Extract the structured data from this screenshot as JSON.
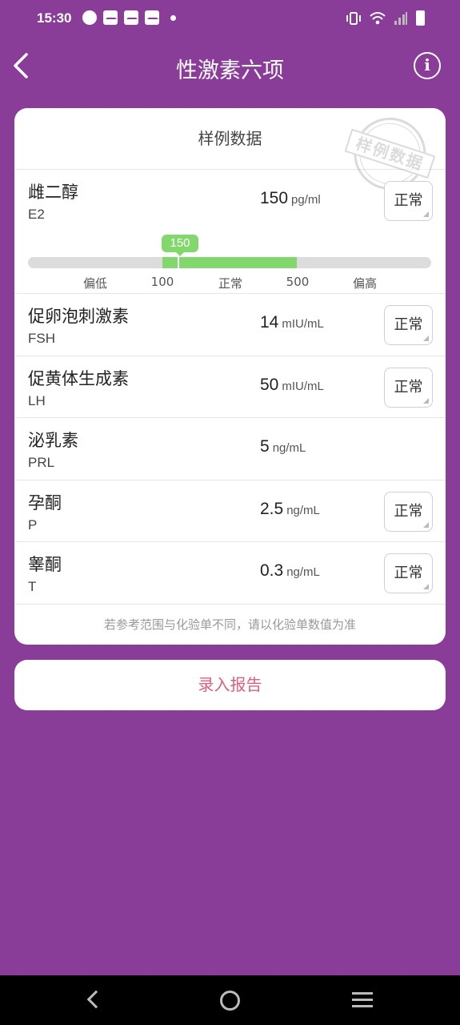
{
  "status_bar": {
    "time": "15:30"
  },
  "header": {
    "title": "性激素六项",
    "info_icon": "i"
  },
  "card": {
    "title": "样例数据",
    "stamp_text": "样例数据",
    "note": "若参考范围与化验单不同，请以化验单数值为准",
    "e2": {
      "name": "雌二醇",
      "code": "E2",
      "value": "150",
      "unit": "pg/ml",
      "status": "正常",
      "range": {
        "low_label": "偏低",
        "low_value": "100",
        "normal_label": "正常",
        "high_value": "500",
        "high_label": "偏高",
        "marker": "150"
      }
    },
    "rows": [
      {
        "name": "促卵泡刺激素",
        "code": "FSH",
        "value": "14",
        "unit": "mIU/mL",
        "status": "正常"
      },
      {
        "name": "促黄体生成素",
        "code": "LH",
        "value": "50",
        "unit": "mIU/mL",
        "status": "正常"
      },
      {
        "name": "泌乳素",
        "code": "PRL",
        "value": "5",
        "unit": "ng/mL",
        "status": ""
      },
      {
        "name": "孕酮",
        "code": "P",
        "value": "2.5",
        "unit": "ng/mL",
        "status": "正常"
      },
      {
        "name": "睾酮",
        "code": "T",
        "value": "0.3",
        "unit": "ng/mL",
        "status": "正常"
      }
    ]
  },
  "entry_button": {
    "label": "录入报告"
  },
  "colors": {
    "background": "#8a3d98",
    "normal_range": "#82d86c",
    "accent_text": "#d9607f"
  }
}
